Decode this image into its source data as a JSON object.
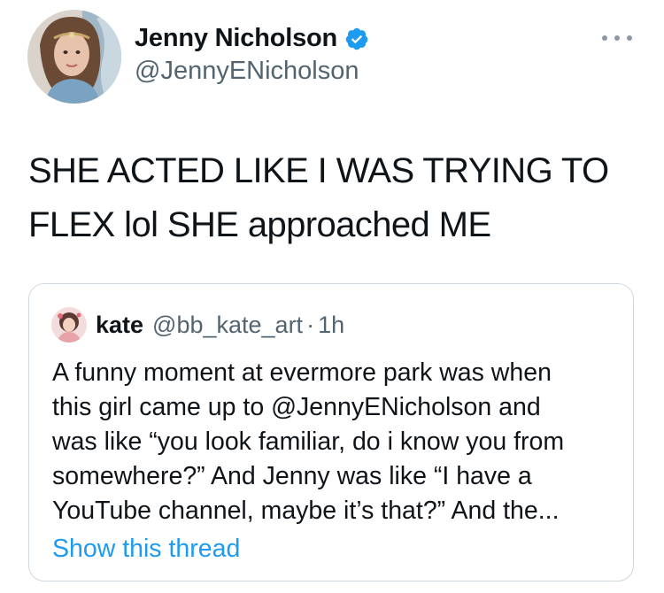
{
  "author": {
    "display_name": "Jenny Nicholson",
    "handle": "@JennyENicholson",
    "verified": true
  },
  "tweet": {
    "text_lines": [
      "SHE ACTED LIKE I WAS TRYING TO",
      "FLEX lol SHE approached ME"
    ]
  },
  "quoted_tweet": {
    "name": "kate",
    "handle": "@bb_kate_art",
    "separator": "·",
    "time": "1h",
    "text_lines": [
      "A funny moment at evermore park was when",
      "this girl came up to @JennyENicholson and",
      "was like “you look familiar, do i know you from",
      "somewhere?” And Jenny was like “I have a",
      "YouTube channel, maybe it’s that?” And the..."
    ],
    "show_thread_label": "Show this thread"
  },
  "icons": {
    "verified": "verified-badge-icon",
    "more": "more-options-icon"
  },
  "colors": {
    "text": "#0f1419",
    "secondary": "#536471",
    "accent": "#1d9bf0",
    "border": "#cfd9de"
  }
}
